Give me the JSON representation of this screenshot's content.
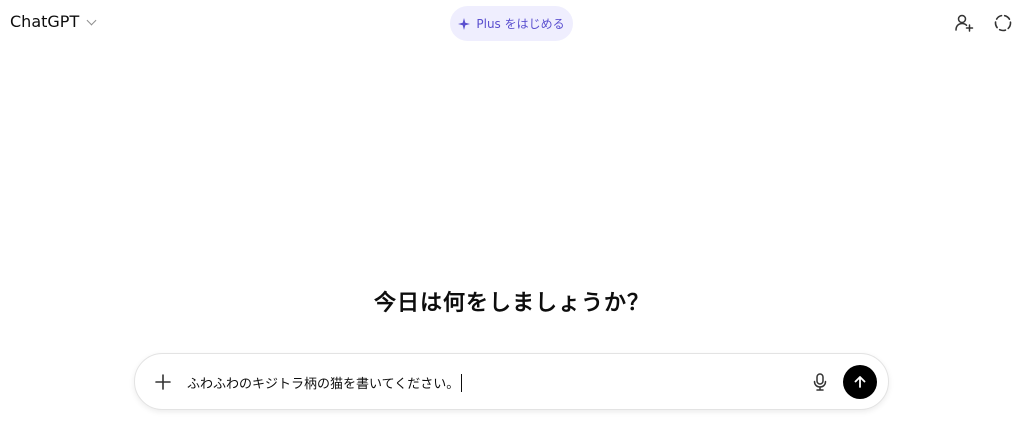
{
  "header": {
    "model_name": "ChatGPT",
    "plus_button_label": "Plus をはじめる",
    "icons": {
      "model_chevron": "chevron-down-icon",
      "plus_sparkle": "sparkle-icon",
      "share": "add-user-icon",
      "temporary_chat": "temporary-chat-icon"
    }
  },
  "main": {
    "greeting": "今日は何をしましょうか？"
  },
  "composer": {
    "input_value": "ふわふわのキジトラ柄の猫を書いてください。",
    "icons": {
      "attach": "plus-icon",
      "voice": "microphone-icon",
      "send": "arrow-up-icon"
    }
  },
  "colors": {
    "accent": "#5a4fcf",
    "pill_background": "#efeefe",
    "send_button": "#000000",
    "text": "#0d0d0d"
  }
}
